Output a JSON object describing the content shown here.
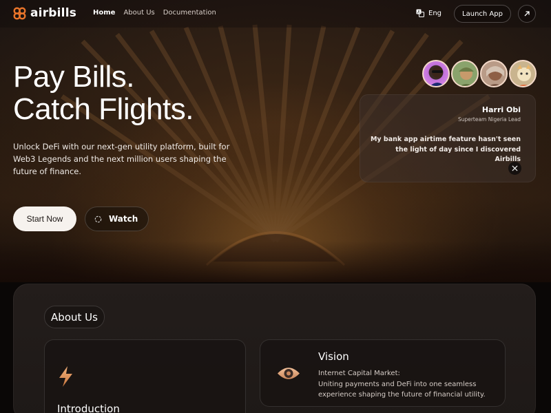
{
  "brand": {
    "name": "airbills",
    "accent": "#e8742a"
  },
  "nav": {
    "links": [
      "Home",
      "About Us",
      "Documentation"
    ],
    "language": "Eng",
    "launch_label": "Launch App"
  },
  "hero": {
    "headline_1": "Pay Bills.",
    "headline_2": "Catch Flights.",
    "subtitle": "Unlock DeFi with our next-gen utility platform, built for Web3 Legends and the next million users shaping the future of finance.",
    "start_label": "Start Now",
    "watch_label": "Watch"
  },
  "testimonial": {
    "name": "Harri Obi",
    "role": "Superteam Nigeria Lead",
    "quote": "My bank app airtime feature hasn't seen the light of day since I discovered Airbills"
  },
  "about": {
    "pill_label": "About Us",
    "intro_title": "Introduction",
    "vision_title": "Vision",
    "vision_line_1": "Internet Capital Market:",
    "vision_line_2": "Uniting payments and DeFi into one seamless",
    "vision_line_3": "experience shaping the future of financial utility."
  },
  "icons": {
    "logo": "airbills-logo-icon",
    "language": "translate-icon",
    "external": "arrow-up-right-icon",
    "watch": "play-circle-icon",
    "social": "x-icon",
    "intro": "lightning-bolt-icon",
    "vision": "eye-icon"
  }
}
